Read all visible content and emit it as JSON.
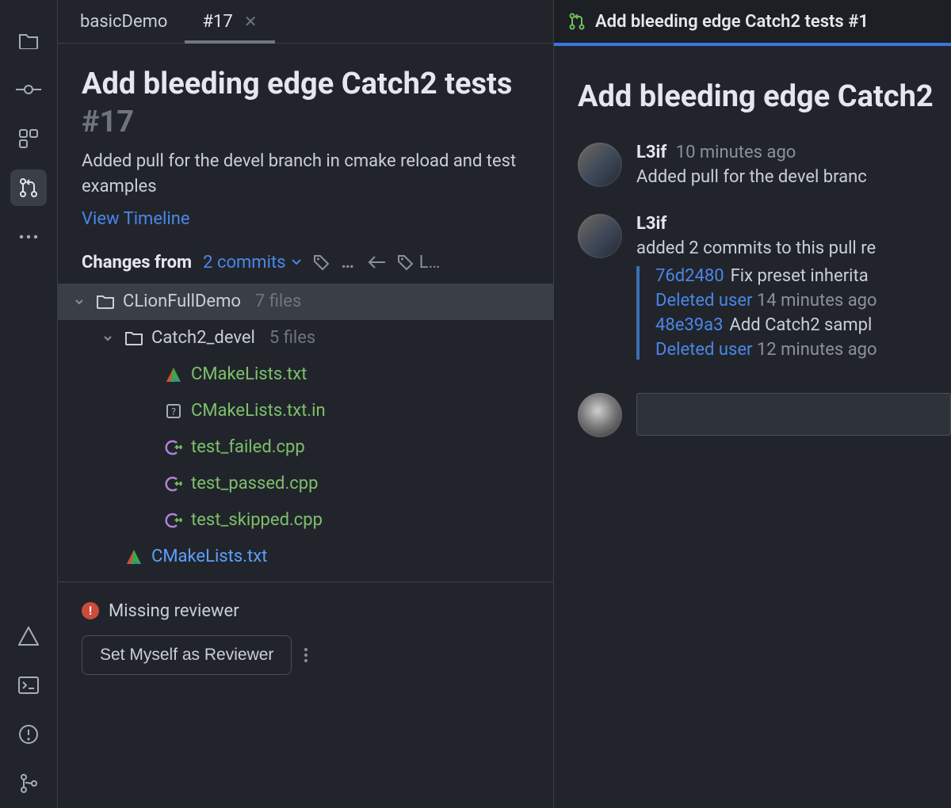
{
  "tabs": {
    "breadcrumb": "basicDemo",
    "active": "#17"
  },
  "pr": {
    "title": "Add bleeding edge Catch2 tests",
    "number": "#17",
    "description": "Added pull for the devel branch in cmake reload and test examples",
    "timeline_link": "View Timeline"
  },
  "changes": {
    "label": "Changes from",
    "link": "2 commits",
    "right_label_truncated": "L…"
  },
  "tree": {
    "root": {
      "name": "CLionFullDemo",
      "count": "7 files"
    },
    "sub": {
      "name": "Catch2_devel",
      "count": "5 files"
    },
    "files": [
      {
        "name": "CMakeLists.txt",
        "icon": "cmake",
        "color": "green"
      },
      {
        "name": "CMakeLists.txt.in",
        "icon": "unknown",
        "color": "green"
      },
      {
        "name": "test_failed.cpp",
        "icon": "cpp",
        "color": "green"
      },
      {
        "name": "test_passed.cpp",
        "icon": "cpp",
        "color": "green"
      },
      {
        "name": "test_skipped.cpp",
        "icon": "cpp",
        "color": "green"
      }
    ],
    "root_file": {
      "name": "CMakeLists.txt",
      "icon": "cmake",
      "color": "blue"
    }
  },
  "reviewer": {
    "warning": "Missing reviewer",
    "button": "Set Myself as Reviewer"
  },
  "right": {
    "tab_label": "Add bleeding edge Catch2 tests #1",
    "title": "Add bleeding edge Catch2",
    "events": [
      {
        "user": "L3if",
        "time": "10 minutes ago",
        "msg": "Added pull for the devel branc"
      },
      {
        "user": "L3if",
        "msg": "added 2 commits to this pull re",
        "commits": [
          {
            "hash": "76d2480",
            "msg": "Fix preset inherita",
            "duser": "Deleted user",
            "ctime": "14 minutes ago"
          },
          {
            "hash": "48e39a3",
            "msg": "Add Catch2 sampl",
            "duser": "Deleted user",
            "ctime": "12 minutes ago"
          }
        ]
      }
    ]
  },
  "icons": {
    "pr_icon": "pull-request-icon"
  }
}
